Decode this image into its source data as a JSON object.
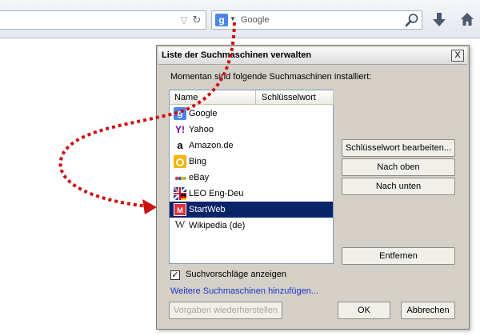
{
  "browser": {
    "search_placeholder": "Google",
    "search_engine_icon": "google-icon"
  },
  "dialog": {
    "title": "Liste der Suchmaschinen verwalten",
    "close_label": "X",
    "intro": "Momentan sind folgende Suchmaschinen installiert:",
    "columns": {
      "name": "Name",
      "keyword": "Schlüsselwort"
    },
    "engines": [
      {
        "name": "Google",
        "keyword": "",
        "icon": "google-icon"
      },
      {
        "name": "Yahoo",
        "keyword": "",
        "icon": "yahoo-icon"
      },
      {
        "name": "Amazon.de",
        "keyword": "",
        "icon": "amazon-icon"
      },
      {
        "name": "Bing",
        "keyword": "",
        "icon": "bing-icon"
      },
      {
        "name": "eBay",
        "keyword": "",
        "icon": "ebay-icon"
      },
      {
        "name": "LEO Eng-Deu",
        "keyword": "",
        "icon": "leo-icon"
      },
      {
        "name": "StartWeb",
        "keyword": "",
        "icon": "startweb-icon",
        "selected": true
      },
      {
        "name": "Wikipedia (de)",
        "keyword": "",
        "icon": "wikipedia-icon"
      }
    ],
    "buttons": {
      "edit_keyword": "Schlüsselwort bearbeiten...",
      "move_up": "Nach oben",
      "move_down": "Nach unten",
      "remove": "Entfernen",
      "restore_defaults": "Vorgaben wiederherstellen",
      "ok": "OK",
      "cancel": "Abbrechen"
    },
    "suggestions_checkbox": {
      "label": "Suchvorschläge anzeigen",
      "checked": true
    },
    "more_engines_link": "Weitere Suchmaschinen hinzufügen..."
  },
  "colors": {
    "selection": "#0a246a",
    "dialog_bg": "#d4d0c8",
    "arrow": "#cc1111",
    "link": "#1a35c7"
  }
}
